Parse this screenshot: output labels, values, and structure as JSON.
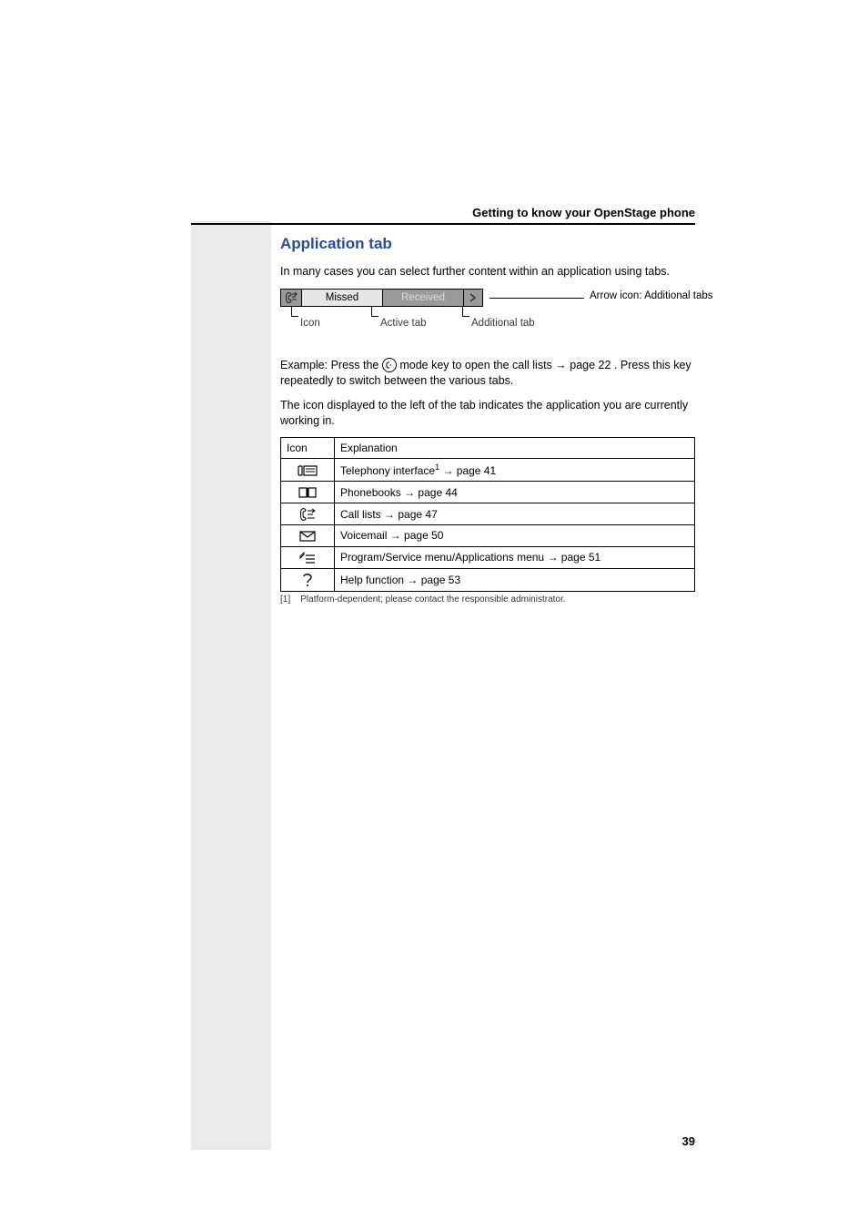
{
  "header": {
    "section": "Getting to know your OpenStage phone"
  },
  "title": "Application tab",
  "intro": "In many cases you can select further content within an application using tabs.",
  "tabs": {
    "missed": "Missed",
    "received": "Received",
    "arrow_label": "Arrow icon: Additional tabs",
    "callout_icon": "Icon",
    "callout_active": "Active tab",
    "callout_additional": "Additional tab"
  },
  "example_before": "Example: Press the ",
  "example_after_icon": " mode key to open the call lists ",
  "example_page_ref": "page 22",
  "example_tail": ". Press this key repeatedly to switch between the various tabs.",
  "icon_para": "The icon displayed to the left of the tab indicates the application you are currently working in.",
  "table": {
    "head_icon": "Icon",
    "head_exp": "Explanation",
    "rows": [
      {
        "exp_prefix": "Telephony interface",
        "sup": "1",
        "page": "page 41"
      },
      {
        "exp_prefix": "Phonebooks",
        "sup": "",
        "page": "page 44"
      },
      {
        "exp_prefix": "Call lists",
        "sup": "",
        "page": "page 47"
      },
      {
        "exp_prefix": "Voicemail",
        "sup": "",
        "page": "page 50"
      },
      {
        "exp_prefix": "Program/Service menu/Applications menu",
        "sup": "",
        "page": "page 51"
      },
      {
        "exp_prefix": "Help function",
        "sup": "",
        "page": "page 53"
      }
    ]
  },
  "footnote_label": "[1]",
  "footnote_text": "Platform-dependent; please contact the responsible administrator.",
  "page_number": "39",
  "glyphs": {
    "arrow": "→"
  }
}
